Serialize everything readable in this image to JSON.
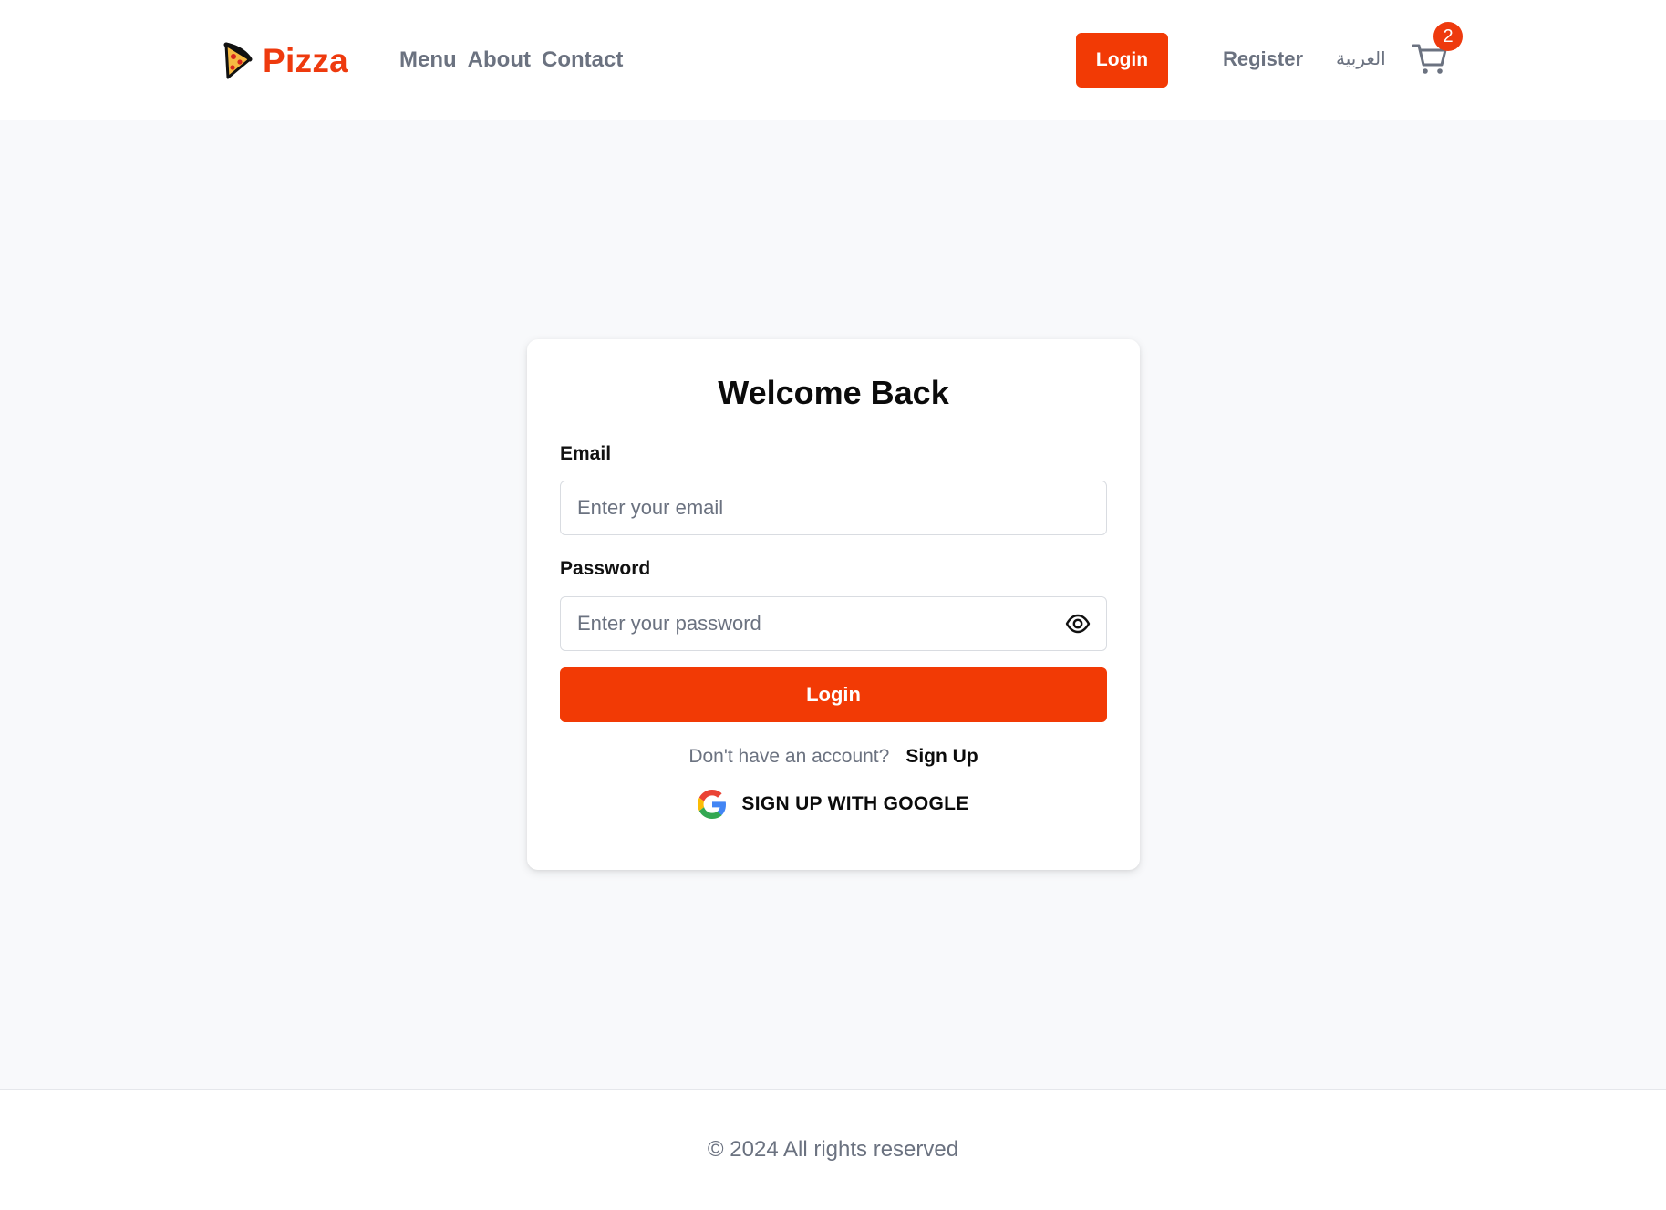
{
  "header": {
    "brand": "Pizza",
    "nav": [
      "Menu",
      "About",
      "Contact"
    ],
    "login_label": "Login",
    "register_label": "Register",
    "language_label": "العربية",
    "cart_count": "2"
  },
  "login_card": {
    "title": "Welcome Back",
    "email_label": "Email",
    "email_placeholder": "Enter your email",
    "password_label": "Password",
    "password_placeholder": "Enter your password",
    "submit_label": "Login",
    "no_account_text": "Don't have an account?",
    "signup_label": "Sign Up",
    "google_label": "SIGN UP WITH GOOGLE"
  },
  "footer": {
    "copyright": "© 2024 All rights reserved"
  },
  "icons": {
    "logo": "pizza-slice-icon",
    "cart": "cart-icon",
    "password_toggle": "eye-icon",
    "google": "google-icon"
  },
  "colors": {
    "accent": "#f23a05",
    "muted_text": "#6b7280",
    "page_bg": "#f8f9fb"
  }
}
